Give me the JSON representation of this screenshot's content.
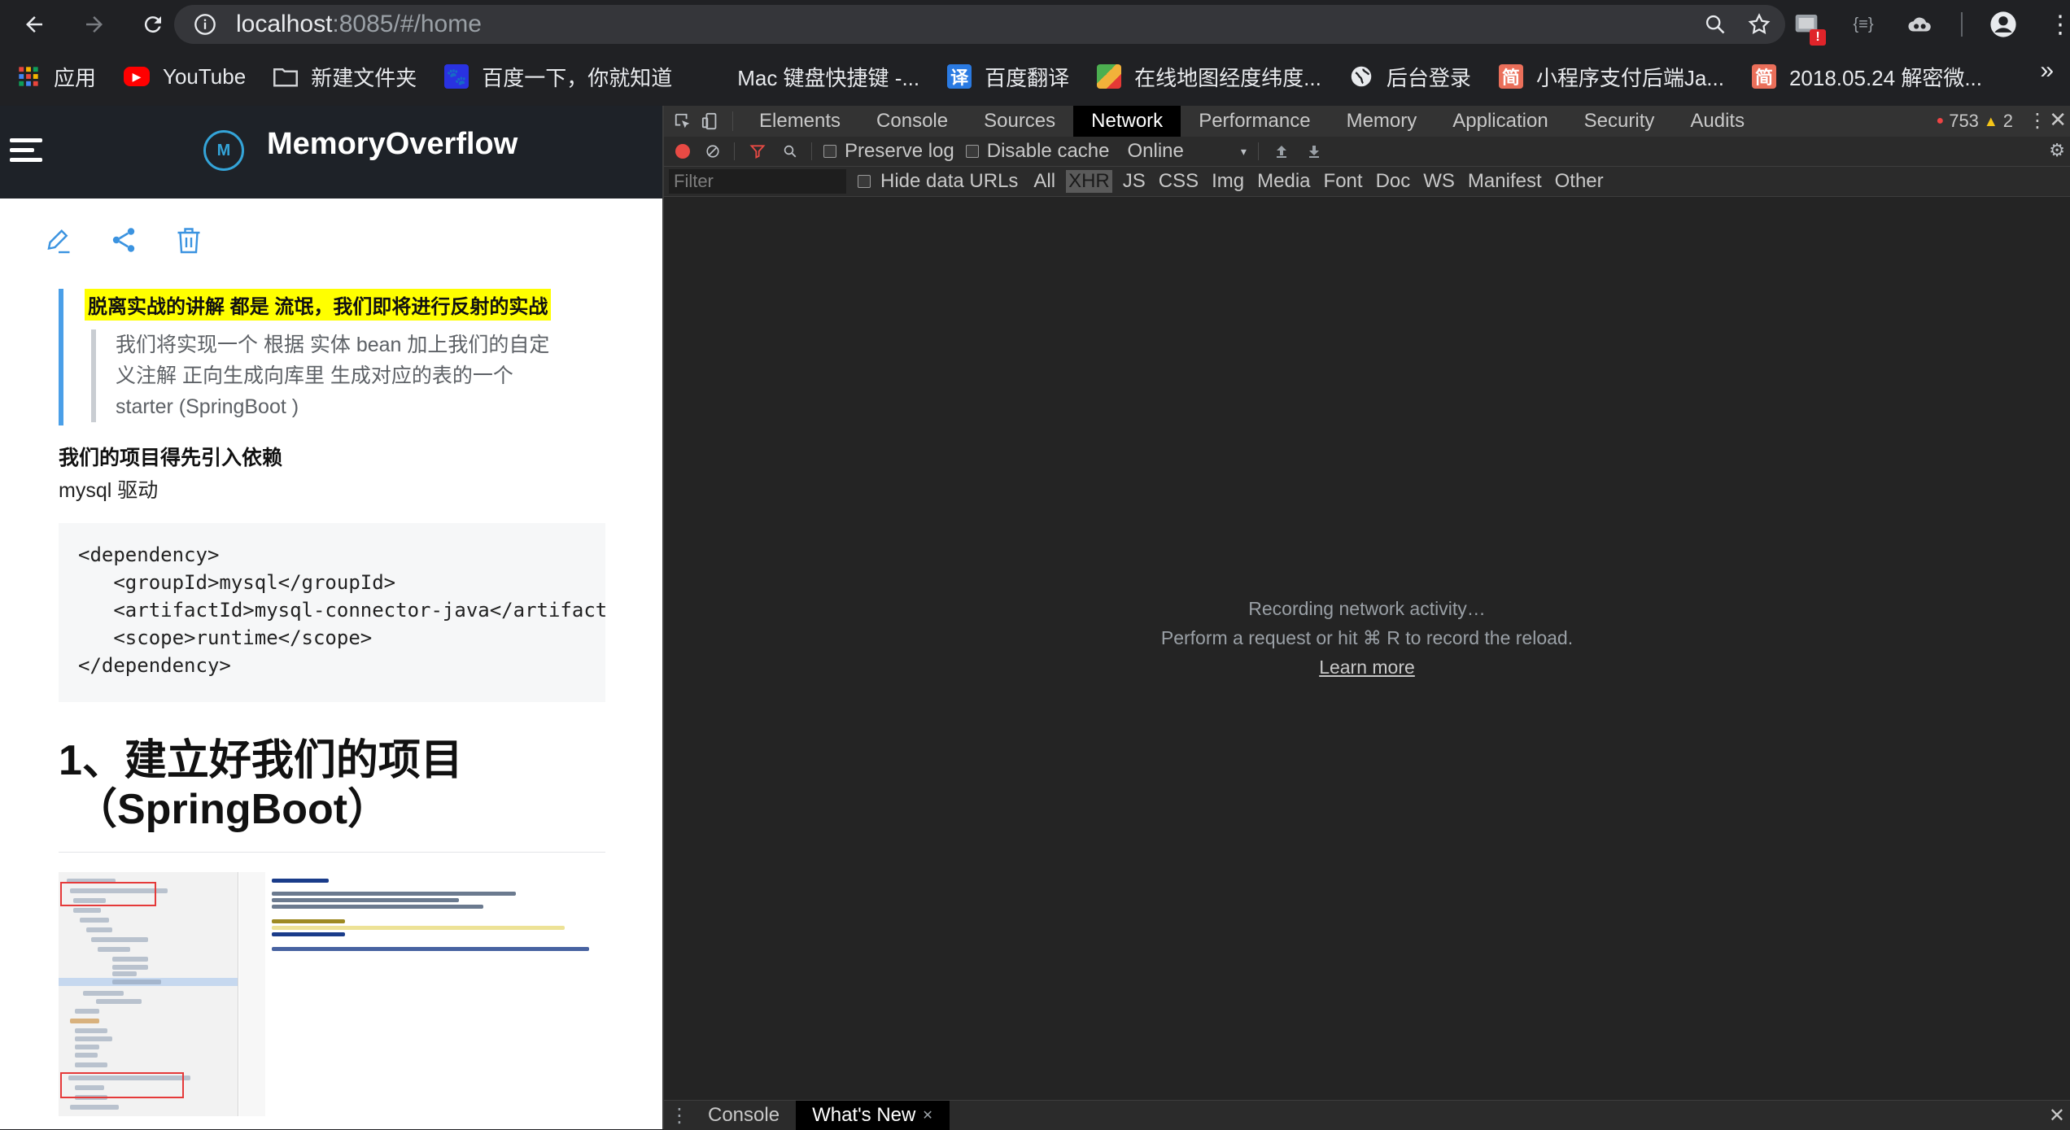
{
  "browser": {
    "url_host": "localhost",
    "url_path": ":8085/#/home",
    "nav": {
      "back_icon": "←",
      "forward_icon": "→",
      "reload_icon": "↻"
    }
  },
  "bookmarks": [
    {
      "label": "应用",
      "icon": "apps-grid-icon",
      "color": "#e8453c"
    },
    {
      "label": "YouTube",
      "icon": "youtube-icon",
      "color": "#ff0000"
    },
    {
      "label": "新建文件夹",
      "icon": "folder-icon",
      "color": "#9aa0a6"
    },
    {
      "label": "百度一下，你就知道",
      "icon": "baidu-icon",
      "color": "#2932e1"
    },
    {
      "label": "Mac 键盘快捷键 -...",
      "icon": "apple-icon",
      "color": "#9aa0a6"
    },
    {
      "label": "百度翻译",
      "icon": "translate-icon",
      "color": "#2a7ae2"
    },
    {
      "label": "在线地图经度纬度...",
      "icon": "map-icon",
      "color": "#f2b13a"
    },
    {
      "label": "后台登录",
      "icon": "globe-icon",
      "color": "#ffffff"
    },
    {
      "label": "小程序支付后端Ja...",
      "icon": "jianshu-icon",
      "color": "#ea6f5a"
    },
    {
      "label": "2018.05.24 解密微...",
      "icon": "jianshu-icon",
      "color": "#ea6f5a"
    }
  ],
  "bookmarks_more": "»",
  "app": {
    "brand": "MemoryOverflow",
    "brand_logo_letter": "M"
  },
  "article": {
    "highlight": "脱离实战的讲解 都是 流氓，我们即将进行反射的实战",
    "quote_lines": [
      "我们将实现一个 根据 实体 bean 加上我们的自定",
      "义注解 正向生成向库里 生成对应的表的一个",
      "starter (SpringBoot )"
    ],
    "deps_title": "我们的项目得先引入依赖",
    "mysql_text": "mysql 驱动",
    "code": "<dependency>\n   <groupId>mysql</groupId>\n   <artifactId>mysql-connector-java</artifactId>\n   <scope>runtime</scope>\n</dependency>",
    "heading_line1": "1、建立好我们的项目",
    "heading_line2": "（SpringBoot）"
  },
  "devtools": {
    "tabs": [
      "Elements",
      "Console",
      "Sources",
      "Network",
      "Performance",
      "Memory",
      "Application",
      "Security",
      "Audits"
    ],
    "active_tab": "Network",
    "error_count": "753",
    "warning_count": "2",
    "toolbar": {
      "preserve_log": "Preserve log",
      "disable_cache": "Disable cache",
      "throttle": "Online"
    },
    "filter": {
      "placeholder": "Filter",
      "hide_data_urls": "Hide data URLs",
      "types": [
        "All",
        "XHR",
        "JS",
        "CSS",
        "Img",
        "Media",
        "Font",
        "Doc",
        "WS",
        "Manifest",
        "Other"
      ],
      "active_type": "XHR"
    },
    "empty_state": {
      "line1": "Recording network activity…",
      "line2": "Perform a request or hit ⌘ R to record the reload.",
      "link": "Learn more"
    },
    "drawer": {
      "tabs": [
        "Console",
        "What's New"
      ],
      "active_tab": "What's New"
    }
  },
  "colors": {
    "accent_blue": "#4a9fe8",
    "highlight_yellow": "#ffff00",
    "record_red": "#e84a44"
  }
}
